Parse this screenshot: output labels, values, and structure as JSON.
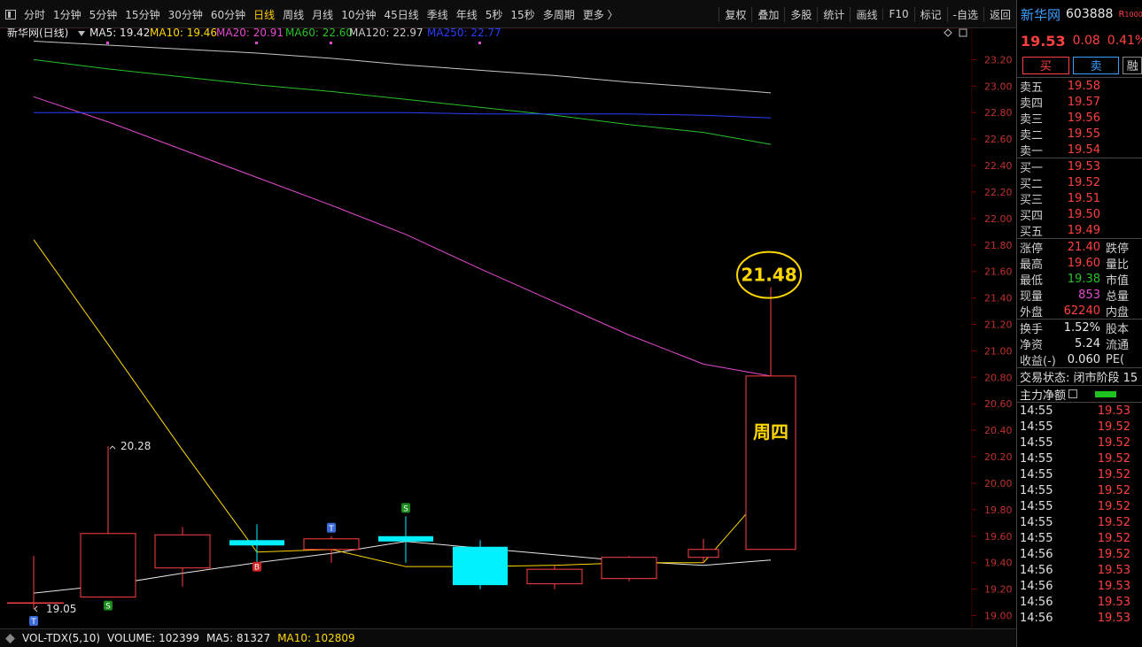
{
  "toolbar": {
    "menu_icon": "panel-toggle-icon",
    "periods": [
      "分时",
      "1分钟",
      "5分钟",
      "15分钟",
      "30分钟",
      "60分钟",
      "日线",
      "周线",
      "月线",
      "10分钟",
      "45日线",
      "季线",
      "年线",
      "5秒",
      "15秒",
      "多周期",
      "更多 〉"
    ],
    "active_period": "日线",
    "right_items": [
      "复权",
      "叠加",
      "多股",
      "统计",
      "画线",
      "F10",
      "标记",
      "-自选",
      "返回"
    ]
  },
  "chart_header": {
    "title": "新华网(日线)",
    "ma_items": [
      {
        "label": "MA5: 19.42",
        "color": "#e8e8e8"
      },
      {
        "label": "MA10: 19.46",
        "color": "#ffd700"
      },
      {
        "label": "MA20: 20.91",
        "color": "#e64ad2"
      },
      {
        "label": "MA60: 22.60",
        "color": "#27c227"
      },
      {
        "label": "MA120: 22.97",
        "color": "#c8c8c8"
      },
      {
        "label": "MA250: 22.77",
        "color": "#2a3fff"
      }
    ],
    "corner_icons": [
      "diamond-icon",
      "square-icon"
    ]
  },
  "chart_data": {
    "type": "candlestick",
    "y_axis_ticks": [
      "23.20",
      "23.00",
      "22.80",
      "22.60",
      "22.40",
      "22.20",
      "22.00",
      "21.80",
      "21.60",
      "21.40",
      "21.20",
      "21.00",
      "20.80",
      "20.60",
      "20.40",
      "20.20",
      "20.00",
      "19.80",
      "19.60",
      "19.40",
      "19.20",
      "19.00"
    ],
    "ylim": [
      18.97,
      23.35
    ],
    "candles": [
      {
        "open": 19.1,
        "close": 19.1,
        "high": 19.45,
        "low": 19.05
      },
      {
        "open": 19.14,
        "close": 19.62,
        "high": 20.28,
        "low": 19.14
      },
      {
        "open": 19.36,
        "close": 19.61,
        "high": 19.67,
        "low": 19.22
      },
      {
        "open": 19.57,
        "close": 19.54,
        "high": 19.69,
        "low": 19.4
      },
      {
        "open": 19.5,
        "close": 19.58,
        "high": 19.6,
        "low": 19.4
      },
      {
        "open": 19.6,
        "close": 19.56,
        "high": 19.75,
        "low": 19.4
      },
      {
        "open": 19.52,
        "close": 19.23,
        "high": 19.57,
        "low": 19.2
      },
      {
        "open": 19.24,
        "close": 19.35,
        "high": 19.38,
        "low": 19.2
      },
      {
        "open": 19.28,
        "close": 19.44,
        "high": 19.45,
        "low": 19.26
      },
      {
        "open": 19.44,
        "close": 19.5,
        "high": 19.58,
        "low": 19.4
      },
      {
        "open": 19.5,
        "close": 20.81,
        "high": 21.48,
        "low": 19.5
      }
    ],
    "series": [
      {
        "name": "MA5",
        "color": "#e8e8e8",
        "values": [
          19.17,
          19.23,
          19.32,
          19.4,
          19.47,
          19.56,
          19.51,
          19.46,
          19.41,
          19.38,
          19.42
        ]
      },
      {
        "name": "MA10",
        "color": "#ffd700",
        "values": [
          21.84,
          21.05,
          20.25,
          19.48,
          19.5,
          19.37,
          19.37,
          19.38,
          19.4,
          19.4,
          19.98
        ]
      },
      {
        "name": "MA20",
        "color": "#e64ad2",
        "values": [
          22.92,
          22.73,
          22.52,
          22.31,
          22.1,
          21.88,
          21.62,
          21.37,
          21.12,
          20.9,
          20.81
        ]
      },
      {
        "name": "MA60",
        "color": "#27c227",
        "values": [
          23.2,
          23.13,
          23.07,
          23.01,
          22.96,
          22.9,
          22.84,
          22.78,
          22.71,
          22.65,
          22.56
        ]
      },
      {
        "name": "MA120",
        "color": "#c8c8c8",
        "values": [
          23.34,
          23.31,
          23.28,
          23.25,
          23.21,
          23.16,
          23.12,
          23.08,
          23.03,
          22.99,
          22.95
        ]
      },
      {
        "name": "MA250",
        "color": "#2a3fff",
        "values": [
          22.8,
          22.8,
          22.8,
          22.8,
          22.8,
          22.8,
          22.79,
          22.79,
          22.79,
          22.78,
          22.76
        ]
      }
    ],
    "markers": [
      {
        "candle": 0,
        "label": "T",
        "kind": "T"
      },
      {
        "candle": 1,
        "label": "S",
        "kind": "S"
      },
      {
        "candle": 3,
        "label": "B",
        "kind": "B"
      },
      {
        "candle": 4,
        "label": "T",
        "kind": "T"
      },
      {
        "candle": 5,
        "label": "S",
        "kind": "S"
      }
    ],
    "annotations": {
      "low_label": "19.05",
      "high_label": "20.28",
      "peak_label": "21.48",
      "candle_text": "周四"
    }
  },
  "volume_bar": {
    "name": "VOL-TDX(5,10)",
    "volume": "VOLUME: 102399",
    "ma5": "MA5: 81327",
    "ma10": "MA10: 102809"
  },
  "quote": {
    "name": "新华网",
    "code": "603888",
    "badge": "R",
    "price": "19.53",
    "change": "0.08",
    "pct": "0.41%",
    "buy_label": "买",
    "sell_label": "卖",
    "third_label": "融",
    "asks": [
      {
        "label": "卖五",
        "price": "19.58"
      },
      {
        "label": "卖四",
        "price": "19.57"
      },
      {
        "label": "卖三",
        "price": "19.56"
      },
      {
        "label": "卖二",
        "price": "19.55"
      },
      {
        "label": "卖一",
        "price": "19.54"
      }
    ],
    "bids": [
      {
        "label": "买一",
        "price": "19.53"
      },
      {
        "label": "买二",
        "price": "19.52"
      },
      {
        "label": "买三",
        "price": "19.51"
      },
      {
        "label": "买四",
        "price": "19.50"
      },
      {
        "label": "买五",
        "price": "19.49"
      }
    ],
    "stats1": [
      {
        "label": "涨停",
        "value": "21.40",
        "vcolor": "red",
        "extra": "跌停"
      },
      {
        "label": "最高",
        "value": "19.60",
        "vcolor": "red",
        "extra": "量比"
      },
      {
        "label": "最低",
        "value": "19.38",
        "vcolor": "green",
        "extra": "市值"
      },
      {
        "label": "现量",
        "value": "853",
        "vcolor": "mag",
        "extra": "总量"
      },
      {
        "label": "外盘",
        "value": "62240",
        "vcolor": "red",
        "extra": "内盘"
      }
    ],
    "stats2": [
      {
        "label": "换手",
        "value": "1.52%",
        "vcolor": "wht",
        "extra": "股本"
      },
      {
        "label": "净资",
        "value": "5.24",
        "vcolor": "wht",
        "extra": "流通"
      },
      {
        "label": "收益(-)",
        "value": "0.060",
        "vcolor": "wht",
        "extra": "PE("
      }
    ],
    "trade_status": "交易状态: 闭市阶段 15",
    "net_label": "主力净额",
    "ticks": [
      {
        "time": "14:55",
        "price": "19.53"
      },
      {
        "time": "14:55",
        "price": "19.52"
      },
      {
        "time": "14:55",
        "price": "19.52"
      },
      {
        "time": "14:55",
        "price": "19.52"
      },
      {
        "time": "14:55",
        "price": "19.52"
      },
      {
        "time": "14:55",
        "price": "19.52"
      },
      {
        "time": "14:55",
        "price": "19.52"
      },
      {
        "time": "14:55",
        "price": "19.52"
      },
      {
        "time": "14:55",
        "price": "19.52"
      },
      {
        "time": "14:56",
        "price": "19.52"
      },
      {
        "time": "14:56",
        "price": "19.53"
      },
      {
        "time": "14:56",
        "price": "19.53"
      },
      {
        "time": "14:56",
        "price": "19.53"
      },
      {
        "time": "14:56",
        "price": "19.53"
      }
    ]
  }
}
